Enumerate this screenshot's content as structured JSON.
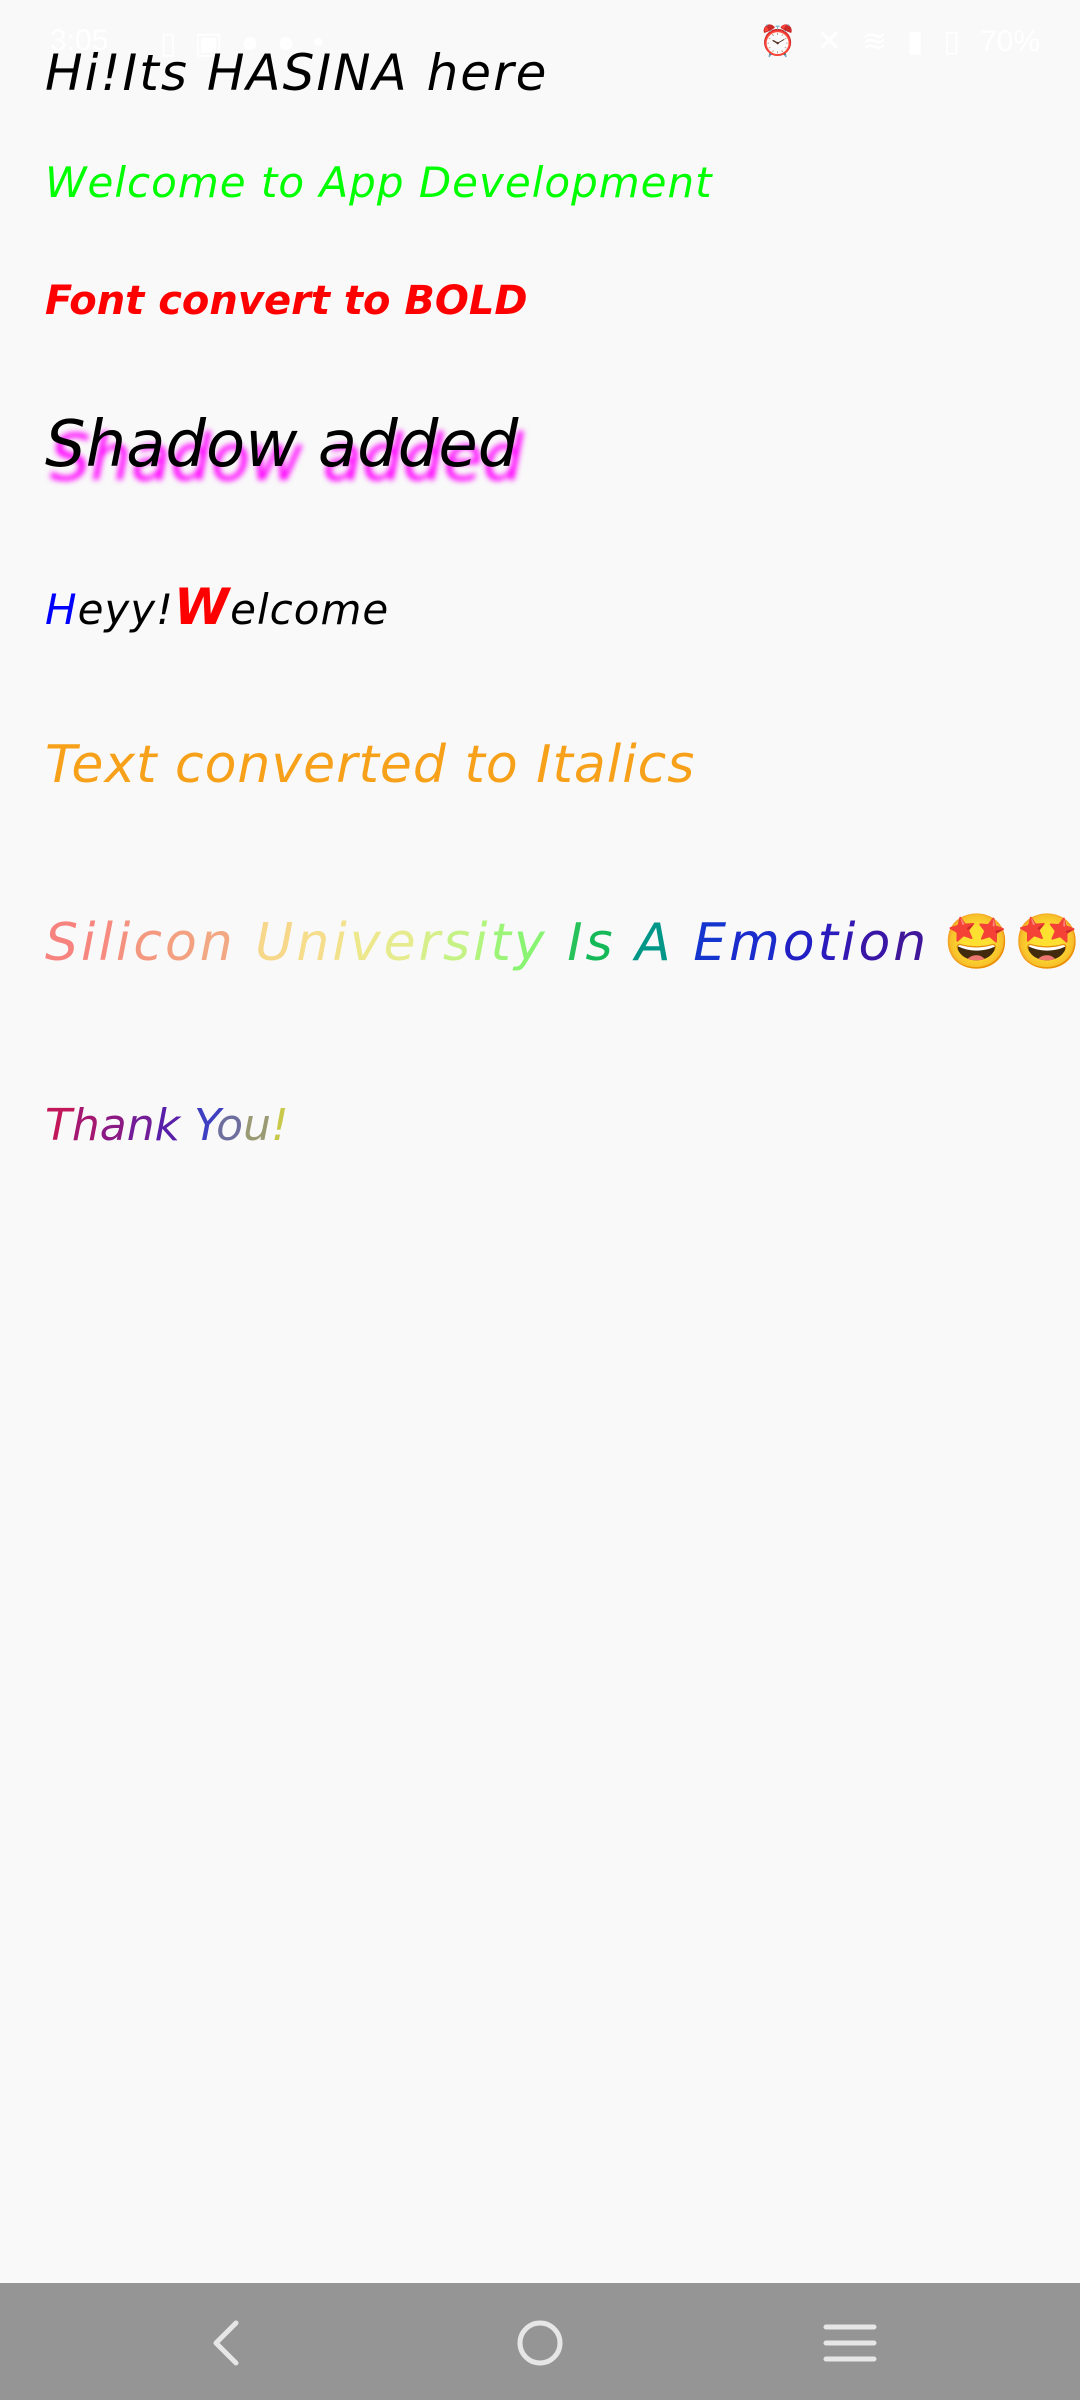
{
  "status_bar": {
    "time": "3:05",
    "battery": "70%",
    "left_icons": [
      "sim-icon",
      "image-icon",
      "app-icon",
      "app-icon",
      "dot-icon"
    ],
    "right_icons": [
      "alarm-icon",
      "mute-icon",
      "wifi-icon",
      "signal-icon",
      "battery-icon"
    ]
  },
  "lines": {
    "greeting": "Hi!Its HASINA here",
    "welcome": "Welcome to App Development",
    "bold_text": "Font convert to BOLD",
    "shadow_text": "Shadow added",
    "heyy": {
      "h": "H",
      "rest": "eyy!",
      "w": "W",
      "tail": "elcome"
    },
    "italics": "Text converted to Italics",
    "rainbow": {
      "chars": [
        "S",
        "i",
        "l",
        "i",
        "c",
        "o",
        "n",
        " ",
        "U",
        "n",
        "i",
        "v",
        "e",
        "r",
        "s",
        "i",
        "t",
        "y",
        " ",
        "I",
        "s",
        " ",
        "A",
        " ",
        "E",
        "m",
        "o",
        "t",
        "i",
        "o",
        "n"
      ],
      "emoji": "🤩🤩"
    },
    "thank_you": {
      "chars": [
        "T",
        "h",
        "a",
        "n",
        "k",
        " ",
        "Y",
        "o",
        "u",
        "!"
      ]
    }
  },
  "colors": {
    "rainbow": [
      "#f7837f",
      "#f7867e",
      "#f78b7f",
      "#f5917f",
      "#f49980",
      "#f3a181",
      "#f2a983",
      "#ffffff",
      "#f7d78a",
      "#f5dd8b",
      "#f3e28c",
      "#eee88d",
      "#e6ec8d",
      "#d7ef8b",
      "#c5f285",
      "#b1f47e",
      "#9cf478",
      "#88f472",
      "#ffffff",
      "#27c25a",
      "#15b957",
      "#ffffff",
      "#009688",
      "#ffffff",
      "#1436cf",
      "#1a2ccb",
      "#221fc5",
      "#2a1bbd",
      "#3318b2",
      "#3a16a6",
      "#40169a"
    ],
    "thank_you": [
      "#c2185b",
      "#a51871",
      "#8c1a85",
      "#731d97",
      "#5a1fa8",
      "#ffffff",
      "#3f3fc2",
      "#6e6e9e",
      "#9a9a74",
      "#c8c84a"
    ]
  },
  "nav_bar": {
    "buttons": [
      "back-icon",
      "home-icon",
      "menu-icon"
    ]
  }
}
